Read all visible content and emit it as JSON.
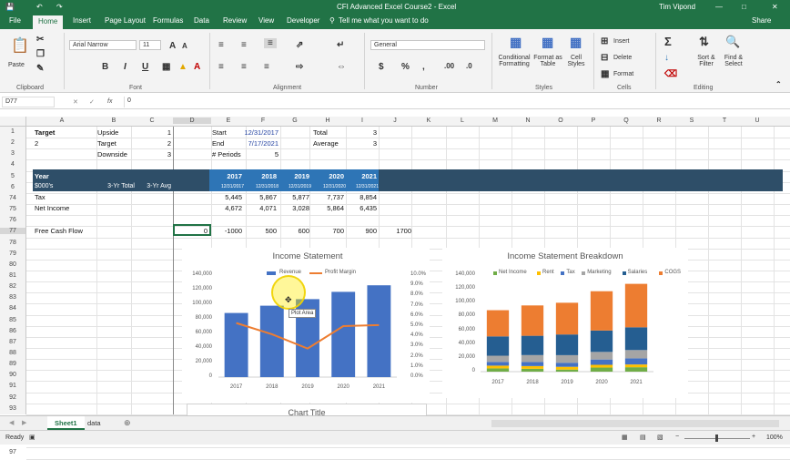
{
  "titlebar": {
    "title": "CFI Advanced Excel Course2 - Excel",
    "user": "Tim Vipond"
  },
  "ribbon_tabs": [
    "File",
    "Home",
    "Insert",
    "Page Layout",
    "Formulas",
    "Data",
    "Review",
    "View",
    "Developer"
  ],
  "tell_me": "Tell me what you want to do",
  "share": "Share",
  "ribbon": {
    "font_name": "Arial Narrow",
    "font_size": "11",
    "number_format": "General",
    "groups": [
      "Clipboard",
      "Font",
      "Alignment",
      "Number",
      "Styles",
      "Cells",
      "Editing"
    ],
    "paste": "Paste",
    "cond_fmt": "Conditional Formatting",
    "fmt_table": "Format as Table",
    "cell_styles": "Cell Styles",
    "insert": "Insert",
    "delete": "Delete",
    "format": "Format",
    "sort": "Sort & Filter",
    "find": "Find & Select"
  },
  "formula_bar": {
    "name_box": "D77",
    "fx": "fx",
    "value": "0"
  },
  "columns": [
    "A",
    "B",
    "C",
    "D",
    "E",
    "F",
    "G",
    "H",
    "I",
    "J",
    "K",
    "L",
    "M",
    "N",
    "O",
    "P",
    "Q",
    "R",
    "S",
    "T",
    "U"
  ],
  "rows": [
    "1",
    "2",
    "3",
    "4",
    "5",
    "6",
    "74",
    "75",
    "76",
    "77",
    "78",
    "79",
    "80",
    "81",
    "82",
    "83",
    "84",
    "85",
    "86",
    "87",
    "88",
    "89",
    "90",
    "91",
    "92",
    "93",
    "94",
    "95",
    "96",
    "97"
  ],
  "cells": {
    "a1": "Target",
    "b1": "Upside",
    "c1": "1",
    "e1": "Start",
    "f1": "12/31/2017",
    "h1": "Total",
    "i1": "3",
    "a2": "2",
    "b2": "Target",
    "c2": "2",
    "e2": "End",
    "f2": "7/17/2021",
    "h2": "Average",
    "i2": "3",
    "b3": "Downside",
    "c3": "3",
    "e3": "# Periods",
    "f3": "5",
    "a5": "Year",
    "a6": "$000's",
    "b6": "3-Yr Total",
    "c6": "3-Yr Avg",
    "years": [
      "2017",
      "2018",
      "2019",
      "2020",
      "2021"
    ],
    "dates": [
      "12/31/2017",
      "12/31/2018",
      "12/31/2019",
      "12/31/2020",
      "12/31/2021"
    ],
    "a74": "Tax",
    "tax": [
      "5,445",
      "5,867",
      "5,877",
      "7,737",
      "8,854"
    ],
    "a75": "Net Income",
    "ni": [
      "4,672",
      "4,071",
      "3,028",
      "5,864",
      "6,435"
    ],
    "a77": "Free Cash Flow",
    "fcf": [
      "0",
      "-1000",
      "500",
      "600",
      "700",
      "900",
      "1700"
    ]
  },
  "chart1": {
    "title": "Income Statement",
    "legend": [
      "Revenue",
      "Profit Margin"
    ],
    "tooltip": "Plot Area",
    "y_ticks": [
      "140,000",
      "120,000",
      "100,000",
      "80,000",
      "60,000",
      "40,000",
      "20,000",
      "0"
    ],
    "y2_ticks": [
      "10.0%",
      "9.0%",
      "8.0%",
      "7.0%",
      "6.0%",
      "5.0%",
      "4.0%",
      "3.0%",
      "2.0%",
      "1.0%",
      "0.0%"
    ]
  },
  "chart2": {
    "title": "Income Statement Breakdown",
    "legend": [
      "Net Income",
      "Rent",
      "Tax",
      "Marketing",
      "Salaries",
      "COGS"
    ],
    "y_ticks": [
      "140,000",
      "120,000",
      "100,000",
      "80,000",
      "60,000",
      "40,000",
      "20,000",
      "0"
    ]
  },
  "chart3": {
    "title": "Chart Title"
  },
  "chart_data": [
    {
      "type": "bar",
      "title": "Income Statement",
      "categories": [
        "2017",
        "2018",
        "2019",
        "2020",
        "2021"
      ],
      "series": [
        {
          "name": "Revenue",
          "values": [
            88000,
            98000,
            107000,
            117000,
            126000
          ]
        },
        {
          "name": "Profit Margin",
          "type": "line",
          "axis": "secondary",
          "values": [
            5.3,
            4.2,
            2.8,
            5.0,
            5.1
          ]
        }
      ],
      "ylim": [
        0,
        140000
      ],
      "y2lim": [
        0,
        10
      ],
      "colors": [
        "#4472c4",
        "#ed7d31"
      ]
    },
    {
      "type": "bar",
      "stacked": true,
      "title": "Income Statement Breakdown",
      "categories": [
        "2017",
        "2018",
        "2019",
        "2020",
        "2021"
      ],
      "series": [
        {
          "name": "Net Income",
          "values": [
            4700,
            4100,
            3000,
            5900,
            6400
          ]
        },
        {
          "name": "Rent",
          "values": [
            4000,
            4000,
            4000,
            4000,
            4000
          ]
        },
        {
          "name": "Tax",
          "values": [
            5400,
            5900,
            5900,
            7700,
            8900
          ]
        },
        {
          "name": "Marketing",
          "values": [
            9000,
            10000,
            11000,
            11000,
            12000
          ]
        },
        {
          "name": "Salaries",
          "values": [
            28000,
            28000,
            30000,
            31000,
            33000
          ]
        },
        {
          "name": "COGS",
          "values": [
            38000,
            44000,
            46000,
            57000,
            63000
          ]
        }
      ],
      "ylim": [
        0,
        140000
      ],
      "colors": [
        "#70ad47",
        "#ffc000",
        "#4472c4",
        "#a5a5a5",
        "#255e91",
        "#ed7d31"
      ]
    }
  ],
  "sheets": [
    "Sheet1",
    "data"
  ],
  "status": {
    "ready": "Ready",
    "zoom": "100%"
  }
}
